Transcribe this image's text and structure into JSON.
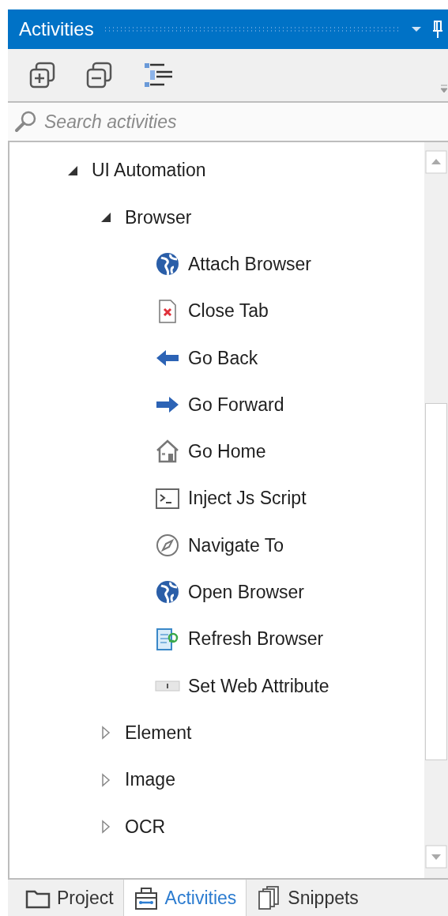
{
  "panel": {
    "title": "Activities"
  },
  "search": {
    "placeholder": "Search activities"
  },
  "tree": [
    {
      "label": "UI Automation",
      "expanded": true,
      "children": [
        {
          "label": "Browser",
          "expanded": true,
          "children": [
            {
              "label": "Attach Browser",
              "kind": "globe"
            },
            {
              "label": "Close Tab",
              "kind": "closetab"
            },
            {
              "label": "Go Back",
              "kind": "back"
            },
            {
              "label": "Go Forward",
              "kind": "forward"
            },
            {
              "label": "Go Home",
              "kind": "home"
            },
            {
              "label": "Inject Js Script",
              "kind": "console"
            },
            {
              "label": "Navigate To",
              "kind": "compass"
            },
            {
              "label": "Open Browser",
              "kind": "globe"
            },
            {
              "label": "Refresh Browser",
              "kind": "refresh"
            },
            {
              "label": "Set Web Attribute",
              "kind": "attribute"
            }
          ]
        },
        {
          "label": "Element",
          "expanded": false
        },
        {
          "label": "Image",
          "expanded": false
        },
        {
          "label": "OCR",
          "expanded": false
        }
      ]
    }
  ],
  "tabs": [
    {
      "label": "Project",
      "kind": "folder",
      "selected": false
    },
    {
      "label": "Activities",
      "kind": "toolbox",
      "selected": true
    },
    {
      "label": "Snippets",
      "kind": "pages",
      "selected": false
    }
  ]
}
